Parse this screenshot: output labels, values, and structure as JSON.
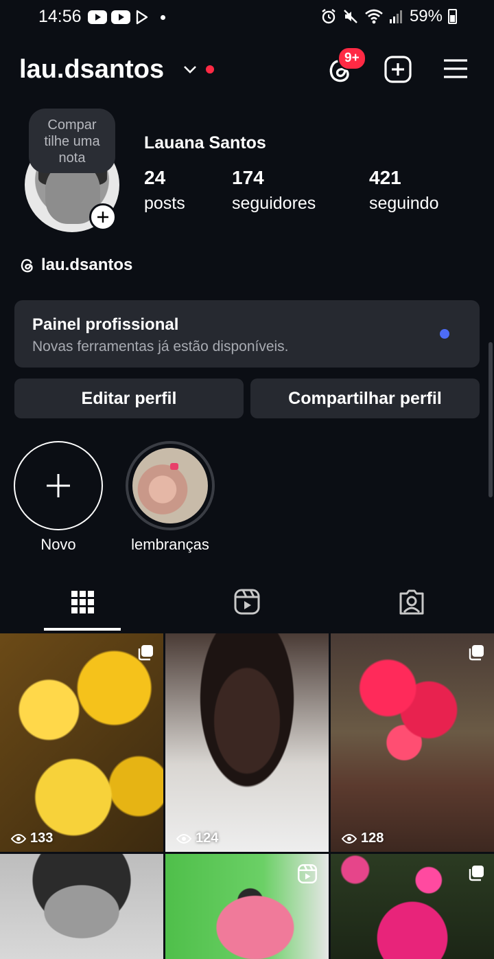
{
  "status_bar": {
    "time": "14:56",
    "battery": "59%"
  },
  "header": {
    "username": "lau.dsantos",
    "threads_badge": "9+"
  },
  "profile": {
    "note_line1": "Compar",
    "note_line2": "tilhe uma",
    "note_line3": "nota",
    "full_name": "Lauana Santos",
    "stats": [
      {
        "num": "24",
        "label": "posts"
      },
      {
        "num": "174",
        "label": "seguidores"
      },
      {
        "num": "421",
        "label": "seguindo"
      }
    ],
    "threads_handle": "lau.dsantos"
  },
  "pro_panel": {
    "title": "Painel profissional",
    "subtitle": "Novas ferramentas já estão disponíveis."
  },
  "buttons": {
    "edit": "Editar perfil",
    "share": "Compartilhar perfil"
  },
  "highlights": [
    {
      "label": "Novo"
    },
    {
      "label": "lembranças"
    }
  ],
  "grid": [
    {
      "views": "133"
    },
    {
      "views": "124"
    },
    {
      "views": "128"
    }
  ],
  "colors": {
    "background": "#0b0e14",
    "panel": "#262930",
    "accent_red": "#ff2a44",
    "accent_blue": "#4d6cf7"
  }
}
